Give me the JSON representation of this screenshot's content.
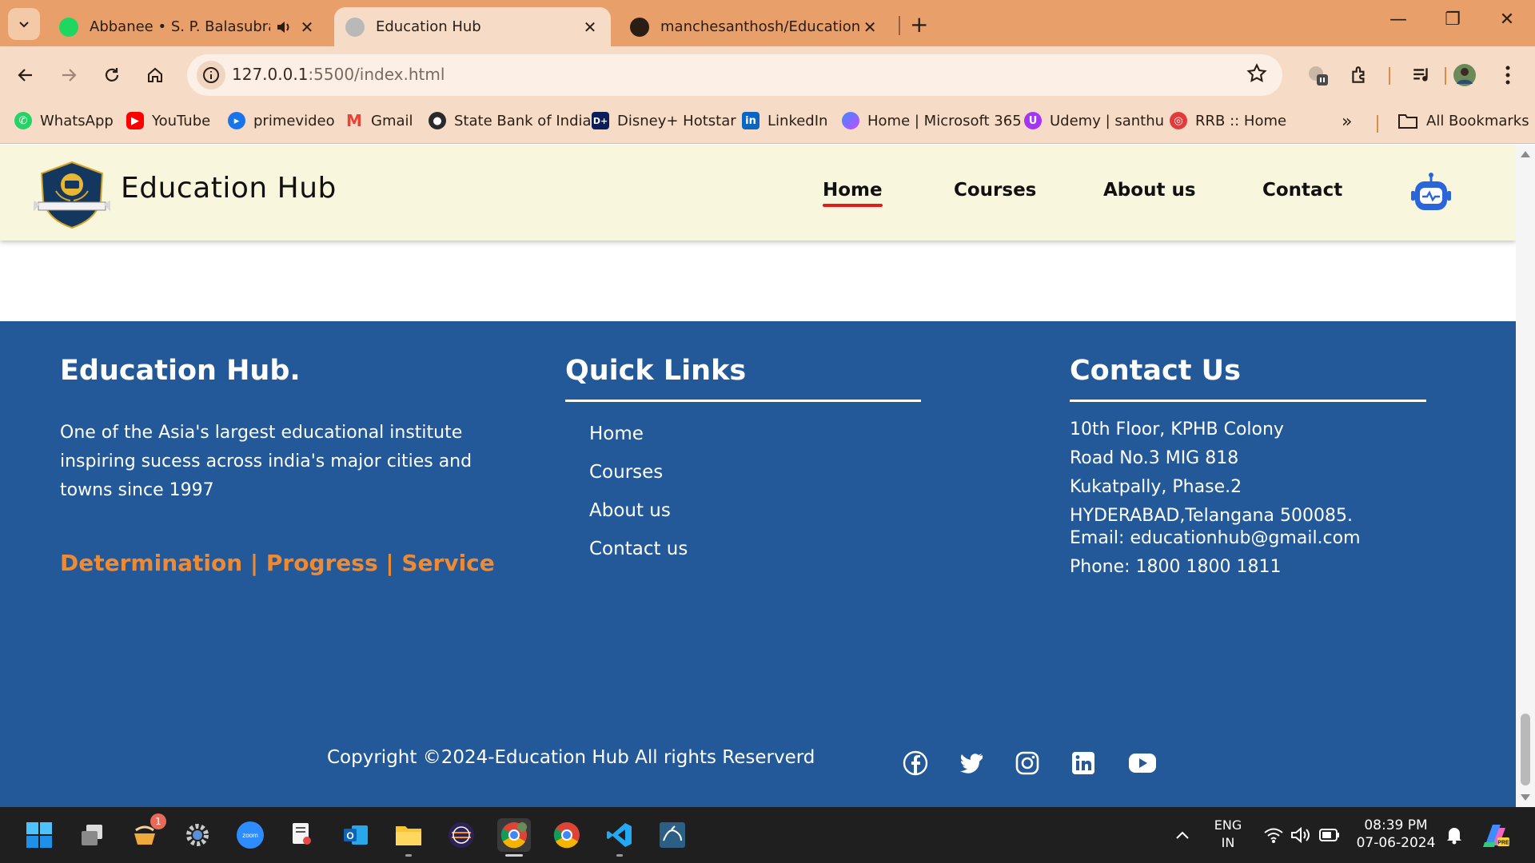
{
  "browser": {
    "tabs": [
      {
        "title": "Abbanee • S. P. Balasubrahmanyam",
        "active": false,
        "audio": true,
        "favicon": "spotify-icon"
      },
      {
        "title": "Education Hub",
        "active": true,
        "favicon": "globe-icon"
      },
      {
        "title": "manchesanthosh/Education-Hub",
        "active": false,
        "favicon": "github-icon"
      }
    ],
    "url_host": "127.0.0.1",
    "url_rest": ":5500/index.html",
    "bookmarks": [
      {
        "label": "WhatsApp",
        "icon": "whatsapp-icon",
        "color": "#25d366"
      },
      {
        "label": "YouTube",
        "icon": "youtube-icon",
        "color": "#ff0000"
      },
      {
        "label": "primevideo",
        "icon": "primevideo-icon",
        "color": "#1a98ff"
      },
      {
        "label": "Gmail",
        "icon": "gmail-icon",
        "color": "#ea4335"
      },
      {
        "label": "State Bank of India",
        "icon": "sbi-icon",
        "color": "#2a2a2a"
      },
      {
        "label": "Disney+ Hotstar",
        "icon": "hotstar-icon",
        "color": "#0b1e5b"
      },
      {
        "label": "LinkedIn",
        "icon": "linkedin-icon",
        "color": "#0a66c2"
      },
      {
        "label": "Home | Microsoft 365",
        "icon": "microsoft365-icon",
        "color": "#7b61ff"
      },
      {
        "label": "Udemy | santhu",
        "icon": "udemy-icon",
        "color": "#a435f0"
      },
      {
        "label": "RRB :: Home",
        "icon": "rrb-icon",
        "color": "#e33b3b"
      }
    ],
    "all_bookmarks": "All Bookmarks"
  },
  "site": {
    "brand": "Education Hub",
    "nav": [
      "Home",
      "Courses",
      "About us",
      "Contact"
    ],
    "active_nav": "Home"
  },
  "footer": {
    "about_title": "Education Hub.",
    "about_lines": [
      "One of the Asia's largest educational institute",
      "inspiring sucess across india's major cities and",
      "towns since 1997"
    ],
    "motto": "Determination | Progress | Service",
    "quick_title": "Quick Links",
    "quick_links": [
      "Home",
      "Courses",
      "About us",
      "Contact us"
    ],
    "contact_title": "Contact Us",
    "address": [
      "10th Floor, KPHB Colony",
      "Road No.3 MIG 818",
      "Kukatpally, Phase.2",
      "HYDERABAD,Telangana 500085."
    ],
    "email": "Email: educationhub@gmail.com",
    "phone": "Phone: 1800 1800 1811",
    "copyright": "Copyright ©2024-Education Hub All rights Reserverd",
    "social": [
      "facebook-icon",
      "twitter-icon",
      "instagram-icon",
      "linkedin-icon",
      "youtube-icon"
    ]
  },
  "taskbar": {
    "language_line1": "ENG",
    "language_line2": "IN",
    "time": "08:39 PM",
    "date": "07-06-2024",
    "notification_count": "1"
  },
  "colors": {
    "footer_bg": "#235998",
    "header_bg": "#f9f6de",
    "accent_orange": "#ee8a33",
    "nav_underline": "#e21b1b",
    "chrome_tab_bg": "#e89f6a"
  }
}
